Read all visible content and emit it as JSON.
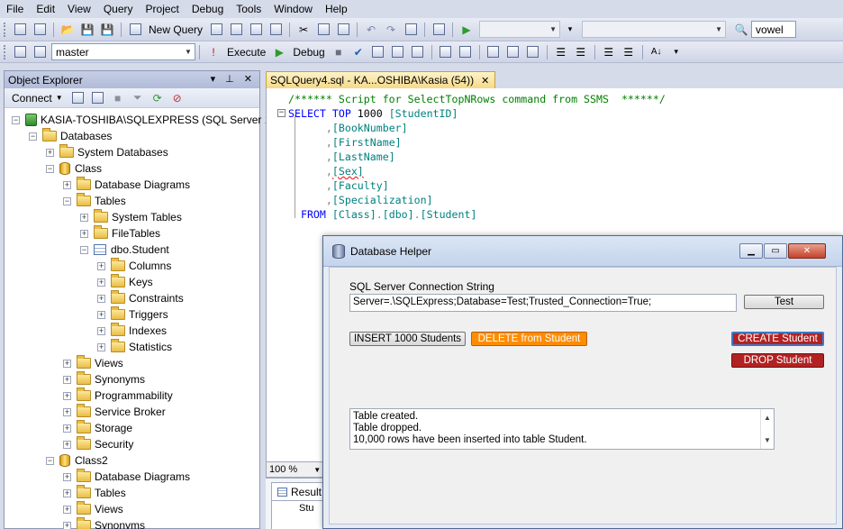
{
  "menu": [
    "File",
    "Edit",
    "View",
    "Query",
    "Project",
    "Debug",
    "Tools",
    "Window",
    "Help"
  ],
  "toolbar": {
    "new_query_label": "New Query",
    "search_value": "vowel",
    "database_value": "master",
    "execute_label": "Execute",
    "debug_label": "Debug"
  },
  "object_explorer": {
    "title": "Object Explorer",
    "connect_label": "Connect",
    "nodes": [
      {
        "label": "KASIA-TOSHIBA\\SQLEXPRESS (SQL Server 11",
        "depth": 0,
        "icon": "server",
        "exp": "−"
      },
      {
        "label": "Databases",
        "depth": 1,
        "icon": "folder",
        "exp": "−"
      },
      {
        "label": "System Databases",
        "depth": 2,
        "icon": "folder",
        "exp": "+"
      },
      {
        "label": "Class",
        "depth": 2,
        "icon": "database",
        "exp": "−"
      },
      {
        "label": "Database Diagrams",
        "depth": 3,
        "icon": "folder",
        "exp": "+"
      },
      {
        "label": "Tables",
        "depth": 3,
        "icon": "folder",
        "exp": "−"
      },
      {
        "label": "System Tables",
        "depth": 4,
        "icon": "folder",
        "exp": "+"
      },
      {
        "label": "FileTables",
        "depth": 4,
        "icon": "folder",
        "exp": "+"
      },
      {
        "label": "dbo.Student",
        "depth": 4,
        "icon": "table",
        "exp": "−"
      },
      {
        "label": "Columns",
        "depth": 5,
        "icon": "folder",
        "exp": "+"
      },
      {
        "label": "Keys",
        "depth": 5,
        "icon": "folder",
        "exp": "+"
      },
      {
        "label": "Constraints",
        "depth": 5,
        "icon": "folder",
        "exp": "+"
      },
      {
        "label": "Triggers",
        "depth": 5,
        "icon": "folder",
        "exp": "+"
      },
      {
        "label": "Indexes",
        "depth": 5,
        "icon": "folder",
        "exp": "+"
      },
      {
        "label": "Statistics",
        "depth": 5,
        "icon": "folder",
        "exp": "+"
      },
      {
        "label": "Views",
        "depth": 3,
        "icon": "folder",
        "exp": "+"
      },
      {
        "label": "Synonyms",
        "depth": 3,
        "icon": "folder",
        "exp": "+"
      },
      {
        "label": "Programmability",
        "depth": 3,
        "icon": "folder",
        "exp": "+"
      },
      {
        "label": "Service Broker",
        "depth": 3,
        "icon": "folder",
        "exp": "+"
      },
      {
        "label": "Storage",
        "depth": 3,
        "icon": "folder",
        "exp": "+"
      },
      {
        "label": "Security",
        "depth": 3,
        "icon": "folder",
        "exp": "+"
      },
      {
        "label": "Class2",
        "depth": 2,
        "icon": "database",
        "exp": "−"
      },
      {
        "label": "Database Diagrams",
        "depth": 3,
        "icon": "folder",
        "exp": "+"
      },
      {
        "label": "Tables",
        "depth": 3,
        "icon": "folder",
        "exp": "+"
      },
      {
        "label": "Views",
        "depth": 3,
        "icon": "folder",
        "exp": "+"
      },
      {
        "label": "Synonyms",
        "depth": 3,
        "icon": "folder",
        "exp": "+"
      }
    ]
  },
  "editor": {
    "tab_label": "SQLQuery4.sql - KA...OSHIBA\\Kasia (54))",
    "zoom": "100 %",
    "results_tab": "Result",
    "results_col_partial": "Stu",
    "lines": [
      {
        "indent": "",
        "parts": [
          {
            "t": "/****** Script for SelectTopNRows command from SSMS  ******/",
            "c": "c-com"
          }
        ]
      },
      {
        "indent": "",
        "parts": [
          {
            "t": "SELECT TOP ",
            "c": "c-kw"
          },
          {
            "t": "1000 ",
            "c": ""
          },
          {
            "t": "[StudentID]",
            "c": "c-id"
          }
        ]
      },
      {
        "indent": "      ",
        "parts": [
          {
            "t": ",",
            "c": "c-gr"
          },
          {
            "t": "[BookNumber]",
            "c": "c-id"
          }
        ]
      },
      {
        "indent": "      ",
        "parts": [
          {
            "t": ",",
            "c": "c-gr"
          },
          {
            "t": "[FirstName]",
            "c": "c-id"
          }
        ]
      },
      {
        "indent": "      ",
        "parts": [
          {
            "t": ",",
            "c": "c-gr"
          },
          {
            "t": "[LastName]",
            "c": "c-id"
          }
        ]
      },
      {
        "indent": "      ",
        "parts": [
          {
            "t": ",",
            "c": "c-gr"
          },
          {
            "t": "[Sex]",
            "c": "c-id sq-under"
          }
        ]
      },
      {
        "indent": "      ",
        "parts": [
          {
            "t": ",",
            "c": "c-gr"
          },
          {
            "t": "[Faculty]",
            "c": "c-id"
          }
        ]
      },
      {
        "indent": "      ",
        "parts": [
          {
            "t": ",",
            "c": "c-gr"
          },
          {
            "t": "[Specialization]",
            "c": "c-id"
          }
        ]
      },
      {
        "indent": "  ",
        "parts": [
          {
            "t": "FROM ",
            "c": "c-kw"
          },
          {
            "t": "[Class]",
            "c": "c-id"
          },
          {
            "t": ".",
            "c": "c-gr"
          },
          {
            "t": "[dbo]",
            "c": "c-id"
          },
          {
            "t": ".",
            "c": "c-gr"
          },
          {
            "t": "[Student]",
            "c": "c-id"
          }
        ]
      }
    ]
  },
  "dialog": {
    "title": "Database Helper",
    "conn_label": "SQL Server Connection String",
    "conn_value": "Server=.\\SQLExpress;Database=Test;Trusted_Connection=True;",
    "test_label": "Test",
    "insert_label": "INSERT 1000 Students",
    "delete_label": "DELETE from Student",
    "create_label": "CREATE Student",
    "drop_label": "DROP Student",
    "log": [
      "Table created.",
      "Table dropped.",
      "10,000 rows have been inserted into table Student."
    ],
    "colors": {
      "delete": "#ff8c00",
      "create": "#b22222",
      "drop": "#b22222"
    }
  }
}
